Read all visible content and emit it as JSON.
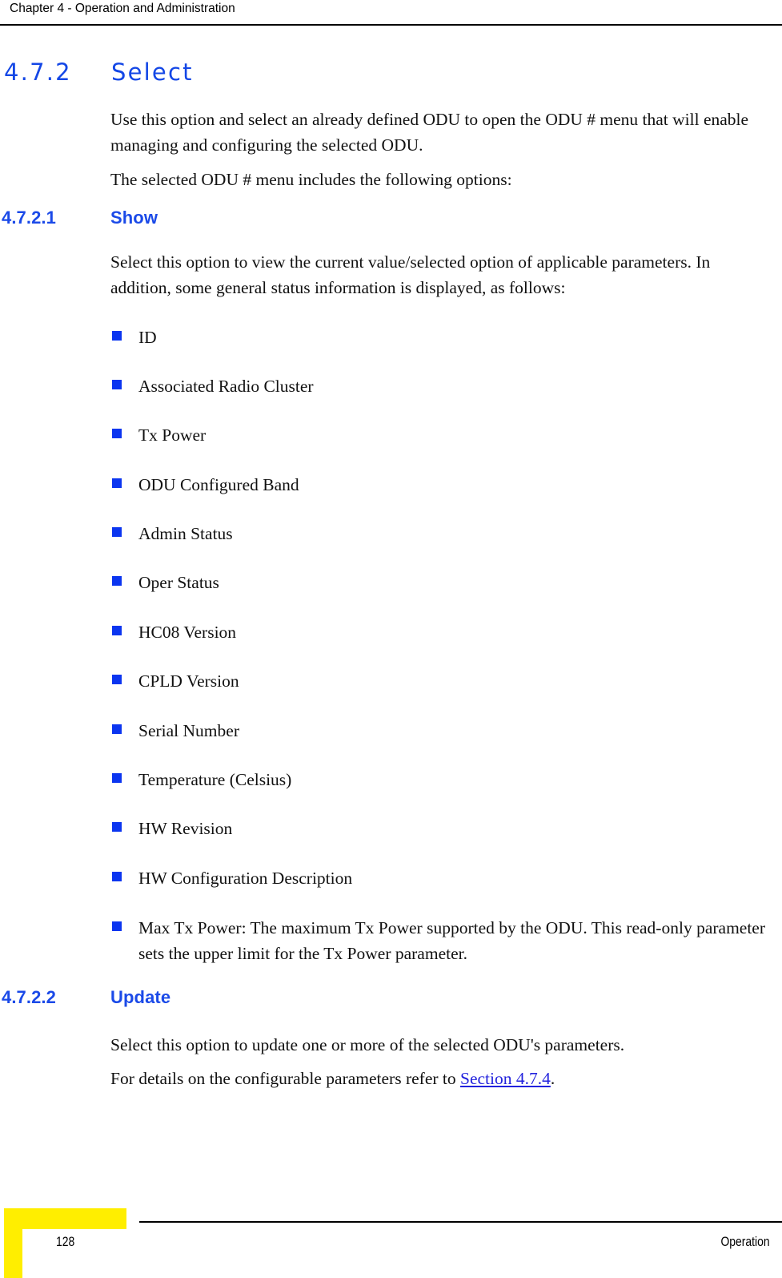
{
  "header": {
    "running_title": "Chapter 4 - Operation and Administration"
  },
  "section": {
    "number": "4.7.2",
    "title": "Select",
    "intro_paragraph_1": "Use this option and select an already defined ODU to open the ODU # menu that will enable managing and configuring the selected ODU.",
    "intro_paragraph_2": "The selected ODU # menu includes the following options:"
  },
  "subsection_show": {
    "number": "4.7.2.1",
    "title": "Show",
    "description": "Select this option to view the current value/selected option of applicable parameters. In addition, some general status information is displayed, as follows:",
    "bullets": [
      "ID",
      "Associated Radio Cluster",
      "Tx Power",
      "ODU Configured Band",
      "Admin Status",
      "Oper Status",
      "HC08 Version",
      "CPLD Version",
      "Serial Number",
      "Temperature (Celsius)",
      "HW Revision",
      "HW Configuration Description",
      "Max Tx Power: The maximum Tx Power supported by the ODU. This read-only parameter sets the upper limit for the Tx Power parameter."
    ]
  },
  "subsection_update": {
    "number": "4.7.2.2",
    "title": "Update",
    "paragraph_1": "Select this option to update one or more of the selected ODU's parameters.",
    "paragraph_2_prefix": "For details on the configurable parameters refer to ",
    "paragraph_2_link": "Section 4.7.4",
    "paragraph_2_suffix": "."
  },
  "footer": {
    "page_number": "128",
    "section_label": "Operation"
  },
  "colors": {
    "heading_blue": "#1447e6",
    "subheading_blue": "#1b4ae8",
    "bullet_blue": "#0b35f0",
    "link_blue": "#2222dd",
    "corner_yellow": "#ffee00",
    "text_black": "#111111"
  },
  "bullet_tops": [
    405,
    466,
    527,
    589,
    650,
    711,
    773,
    834,
    896,
    957,
    1018,
    1080,
    1142
  ]
}
